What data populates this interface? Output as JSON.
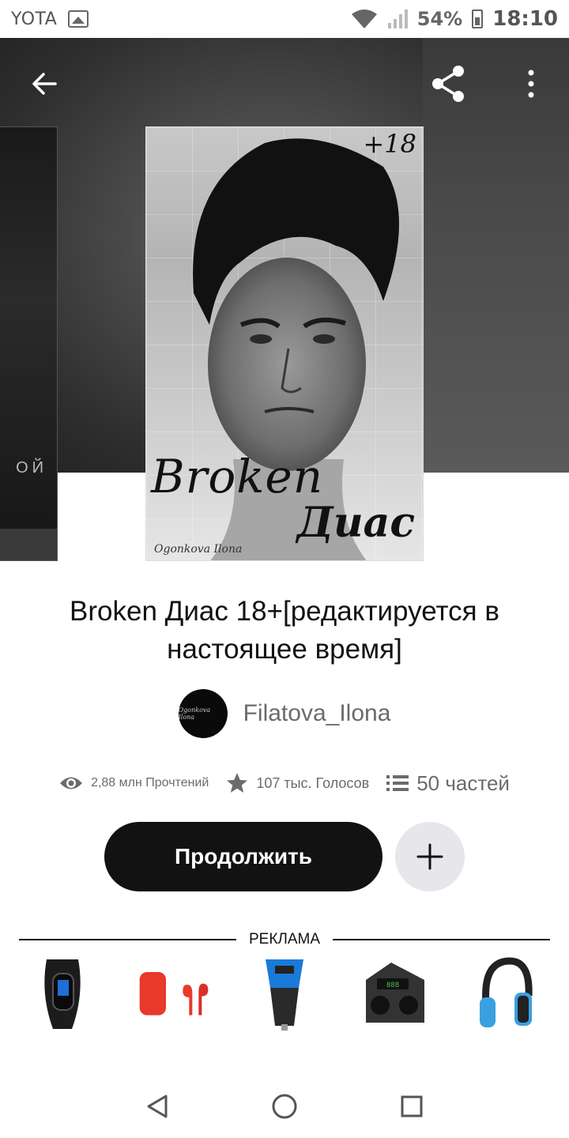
{
  "status_bar": {
    "carrier": "YOTA",
    "battery_percent": "54%",
    "time": "18:10"
  },
  "header": {
    "back_icon": "arrow-left-icon",
    "share_icon": "share-icon",
    "more_icon": "more-vertical-icon"
  },
  "covers": {
    "left_partial_text": "ОЙ",
    "main": {
      "age_mark": "+18",
      "title_line1": "Broken",
      "title_line2": "Диас",
      "author_signature": "Ogonkova Ilona"
    }
  },
  "book": {
    "title": "Broken Диас 18+[редактируется в настоящее время]",
    "author": "Filatova_Ilona",
    "avatar_text": "Ogonkova Ilona"
  },
  "stats": {
    "reads": "2,88 млн Прочтений",
    "votes": "107 тыс. Голосов",
    "parts": "50 частей"
  },
  "actions": {
    "continue_label": "Продолжить",
    "add_icon": "plus-icon"
  },
  "ad": {
    "label": "РЕКЛАМА",
    "items": [
      "fitness-band",
      "red-earbuds-case",
      "car-charger",
      "wireless-earbuds-case",
      "blue-headphones"
    ]
  },
  "colors": {
    "primary_dark": "#121212",
    "secondary_text": "#6b6b6b",
    "add_button_bg": "#e7e6ea"
  }
}
